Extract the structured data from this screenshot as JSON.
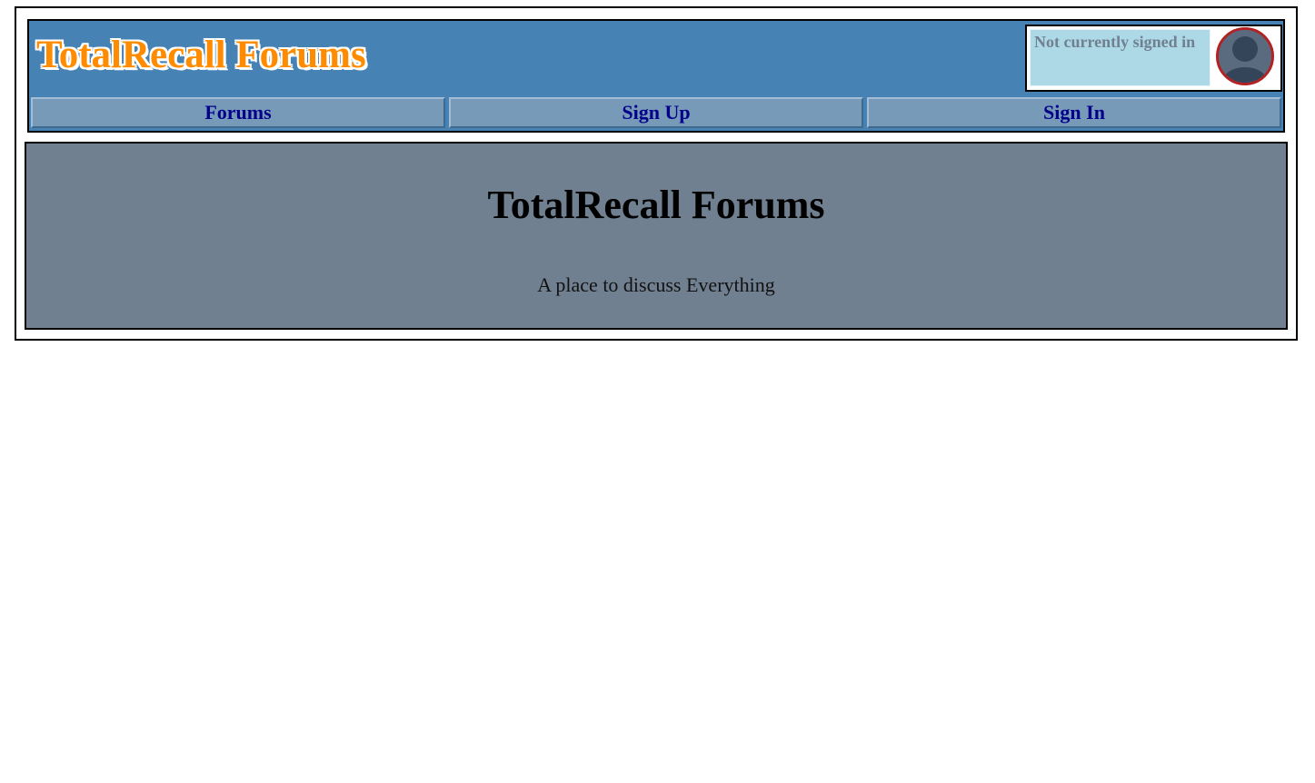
{
  "header": {
    "logo_text": "TotalRecall Forums",
    "user_status": "Not currently signed in",
    "avatar_icon": "default-user-avatar-icon"
  },
  "nav": {
    "items": [
      {
        "label": "Forums"
      },
      {
        "label": "Sign Up"
      },
      {
        "label": "Sign In"
      }
    ]
  },
  "banner": {
    "title": "TotalRecall Forums",
    "tagline": "A place to discuss Everything"
  },
  "colors": {
    "header_bg": "#4682b4",
    "logo_text": "#ff8c00",
    "nav_bg": "#779ab9",
    "nav_text": "#00008b",
    "status_bg": "#add8e6",
    "status_text": "#708090",
    "banner_bg": "#708090",
    "avatar_ring": "#b22222"
  }
}
